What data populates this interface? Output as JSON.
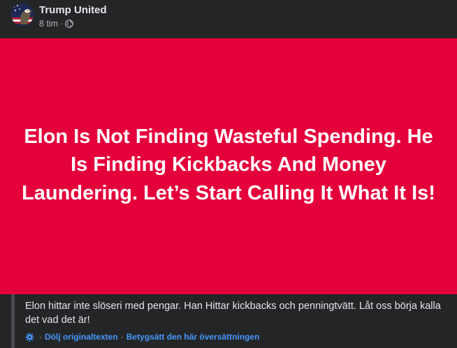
{
  "post": {
    "author": "Trump United",
    "time": "8 tim",
    "separator": "·",
    "privacy_icon": "globe-icon",
    "avatar_icon": "eagle-flag-avatar"
  },
  "banner": {
    "text": "Elon Is Not Finding Wasteful Spending. He Is Finding Kickbacks And Money Laundering. Let’s Start Calling It What It Is!",
    "background": "#e3003b",
    "text_color": "#ffffff"
  },
  "translation": {
    "text": "Elon hittar inte slöseri med pengar. Han Hittar kickbacks och penningtvätt. Låt oss börja kalla det vad det är!",
    "settings_icon": "gear-icon",
    "separator": "·",
    "hide_original_label": "Dölj originaltexten",
    "rate_label": "Betygsätt den här översättningen",
    "link_color": "#4599ff"
  }
}
